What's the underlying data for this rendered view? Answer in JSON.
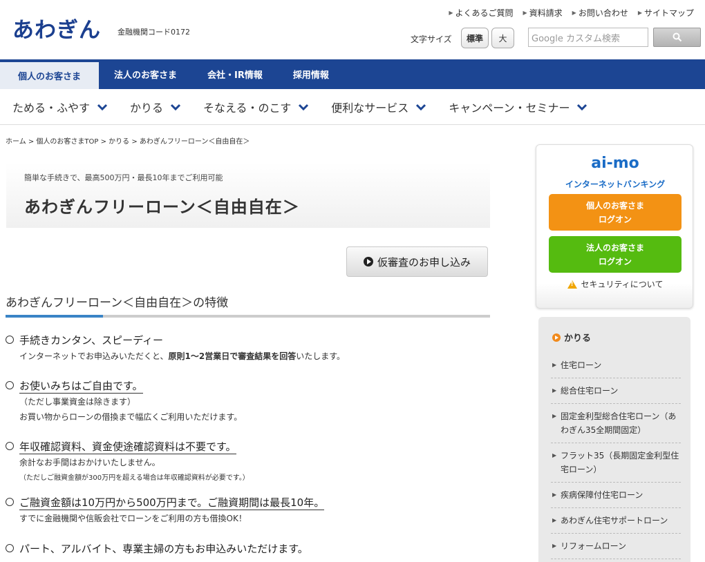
{
  "header": {
    "logo": "あわぎん",
    "bank_code": "金融機関コード0172",
    "util_links": [
      "よくあるご質問",
      "資料請求",
      "お問い合わせ",
      "サイトマップ"
    ],
    "font_size_label": "文字サイズ",
    "font_std": "標準",
    "font_large": "大",
    "search_placeholder": "Google カスタム検索"
  },
  "topnav": [
    "個人のお客さま",
    "法人のお客さま",
    "会社・IR情報",
    "採用情報"
  ],
  "subnav": [
    "ためる・ふやす",
    "かりる",
    "そなえる・のこす",
    "便利なサービス",
    "キャンペーン・セミナー"
  ],
  "breadcrumb": "ホーム > 個人のお客さまTOP > かりる > あわぎんフリーローン＜自由自在＞",
  "titlebox": {
    "sub": "簡単な手続きで、最高500万円・最長10年までご利用可能",
    "title": "あわぎんフリーローン＜自由自在＞"
  },
  "apply_button": "仮審査のお申し込み",
  "section_heading": "あわぎんフリーローン＜自由自在＞の特徴",
  "features": [
    {
      "head": "手続きカンタン、スピーディー",
      "l1": "インターネットでお申込みいただくと、",
      "l1b": "原則1～2営業日で審査結果を回答",
      "l1c": "いたします。"
    },
    {
      "head": "お使いみちはご自由です。",
      "l1": "（ただし事業資金は除きます）",
      "l2": "お買い物からローンの借換まで幅広くご利用いただけます。"
    },
    {
      "head": "年収確認資料、資金使途確認資料は不要です。",
      "l1": "余計なお手間はおかけいたしません。",
      "l2": "（ただしご融資金額が300万円を超える場合は年収確認資料が必要です。）"
    },
    {
      "head": "ご融資金額は10万円から500万円まで。ご融資期間は最長10年。",
      "l1": "すでに金融機関や信販会社でローンをご利用の方も借換OK！"
    },
    {
      "head": "パート、アルバイト、専業主婦の方もお申込みいただけます。"
    }
  ],
  "aimo": {
    "logo": "ai-mo",
    "sub": "インターネットバンキング",
    "personal_l1": "個人のお客さま",
    "personal_l2": "ログオン",
    "corp_l1": "法人のお客さま",
    "corp_l2": "ログオン",
    "security": "セキュリティについて"
  },
  "karu": {
    "title": "かりる",
    "items": [
      [
        "住宅ローン"
      ],
      [
        "総合住宅ローン"
      ],
      [
        "固定金利型総合住宅ローン（あ",
        "わぎん35全期間固定）"
      ],
      [
        "フラット35（長期固定金利型住",
        "宅ローン）"
      ],
      [
        "疾病保障付住宅ローン"
      ],
      [
        "あわぎん住宅サポートローン"
      ],
      [
        "リフォームローン"
      ]
    ]
  },
  "colors": {
    "brand_blue": "#1c4593",
    "orange": "#f39214",
    "green": "#55bb10",
    "accent_blue": "#3a84c6"
  }
}
